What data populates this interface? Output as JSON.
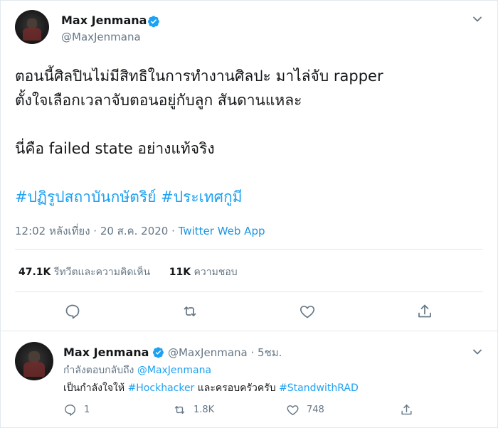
{
  "main_tweet": {
    "author_name": "Max Jenmana",
    "author_handle": "@MaxJenmana",
    "text_line1": "ตอนนี้ศิลปินไม่มีสิทธิในการทำงานศิลปะ มาไล่จับ rapper",
    "text_line2": "ตั้งใจเลือกเวลาจับตอนอยู่กับลูก สันดานแหละ",
    "text_line3": "นี่คือ failed state อย่างแท้จริง",
    "hashtag1": "#ปฏิรูปสถาบันกษัตริย์",
    "hashtag2": "#ประเทศกูมี",
    "timestamp": "12:02 หลังเที่ยง · 20 ส.ค. 2020 · ",
    "source": "Twitter Web App",
    "retweet_count": "47.1K",
    "retweet_label": "รีทวีตและความคิดเห็น",
    "like_count": "11K",
    "like_label": "ความชอบ"
  },
  "reply_tweet": {
    "author_name": "Max Jenmana",
    "author_handle": "@MaxJenmana",
    "time": "· 5ชม.",
    "replying_to_label": "กำลังตอบกลับถึง ",
    "replying_to_handle": "@MaxJenmana",
    "text_before": "เป็นกำลังใจให้ ",
    "hashtag1": "#Hockhacker",
    "text_middle": " และครอบครัวครับ ",
    "hashtag2": "#StandwithRAD",
    "reply_count": "1",
    "retweet_count": "1.8K",
    "like_count": "748"
  },
  "icons": {
    "verified": "verified-badge-icon",
    "menu": "chevron-down-icon",
    "reply": "comment-icon",
    "retweet": "retweet-icon",
    "like": "heart-icon",
    "share": "share-icon"
  },
  "colors": {
    "link": "#1da1f2",
    "secondary_text": "#657786",
    "primary_text": "#14171a",
    "divider": "#e1e8ed"
  }
}
